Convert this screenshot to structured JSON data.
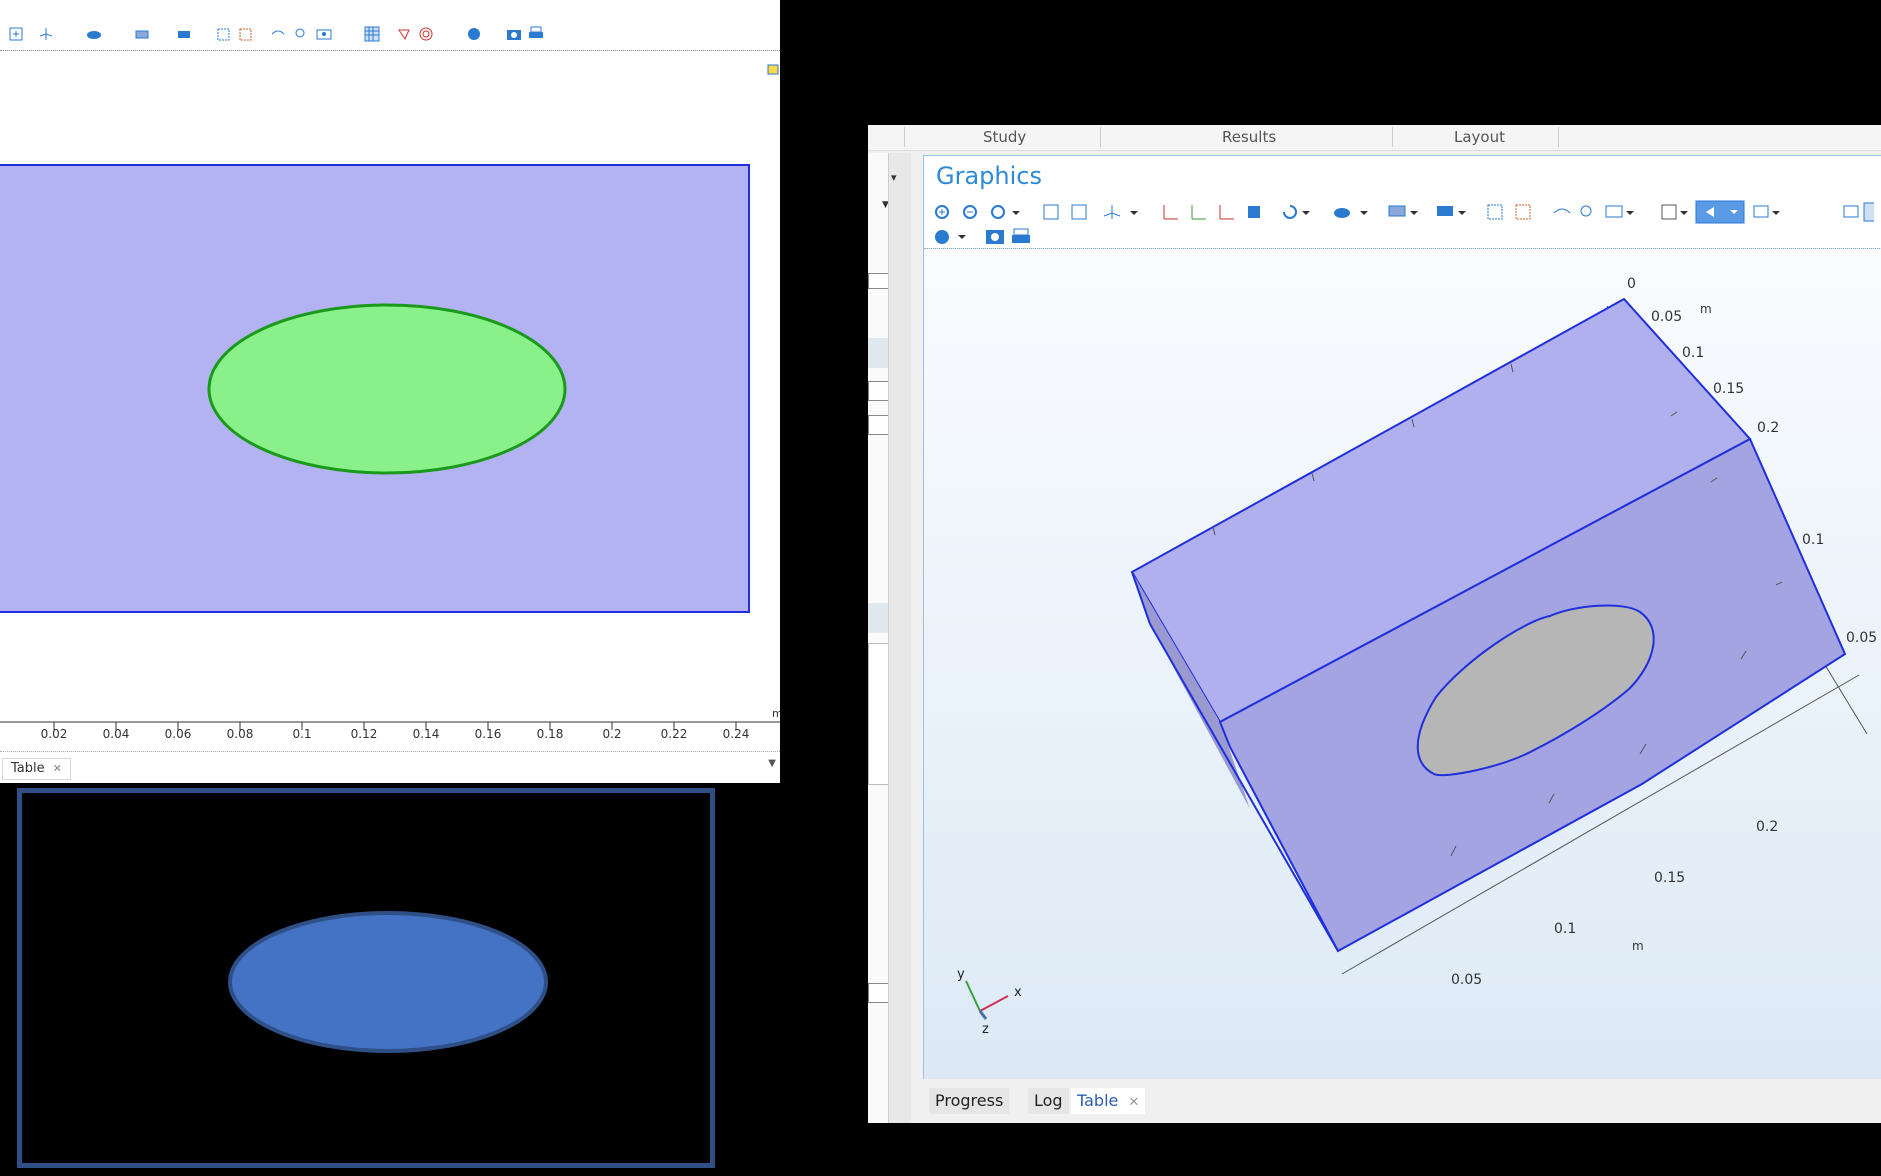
{
  "left_window": {
    "tab_label": "Table",
    "axis_unit": "m",
    "x_ticks": [
      "0.02",
      "0.04",
      "0.06",
      "0.08",
      "0.1",
      "0.12",
      "0.14",
      "0.16",
      "0.18",
      "0.2",
      "0.22",
      "0.24"
    ],
    "colors": {
      "domain_fill": "#b3b3f4",
      "domain_edge": "#1f2fdc",
      "ellipse_fill": "#8af089",
      "ellipse_edge": "#1a9a1a"
    }
  },
  "preview": {
    "colors": {
      "ellipse_fill": "#4472c4",
      "border": "#2f4f87"
    }
  },
  "right_window": {
    "ribbon_tabs": [
      "Study",
      "Results",
      "Layout"
    ],
    "graphics_title": "Graphics",
    "axis_unit": "m",
    "top_ticks": [
      "0",
      "0.05",
      "0.1",
      "0.15",
      "0.2"
    ],
    "right_ticks": [
      "0.1",
      "0.05"
    ],
    "bottom_ticks": [
      "0.2",
      "0.15",
      "0.1",
      "0.05"
    ],
    "triad": {
      "x": "x",
      "y": "y",
      "z": "z"
    },
    "bottom_tabs": [
      {
        "label": "Progress"
      },
      {
        "label": "Log"
      },
      {
        "label": "Table"
      }
    ]
  }
}
